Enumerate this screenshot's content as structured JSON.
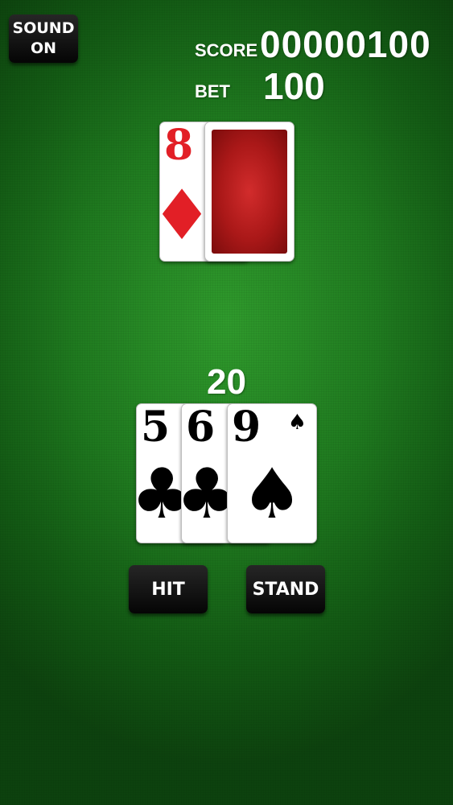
{
  "controls": {
    "sound_line1": "SOUND",
    "sound_line2": "ON",
    "hit_label": "HIT",
    "stand_label": "STAND"
  },
  "hud": {
    "score_label": "SCORE",
    "score_value": "00000100",
    "bet_label": "BET",
    "bet_value": "100"
  },
  "dealer": {
    "cards": [
      {
        "rank": "8",
        "suit": "diamonds",
        "suit_symbol": "♦",
        "color": "#e21f26",
        "face_up": true
      },
      {
        "face_up": false,
        "back_color": "#b81c1c"
      }
    ]
  },
  "player": {
    "total": "20",
    "cards": [
      {
        "rank": "5",
        "suit": "clubs",
        "suit_symbol": "♣",
        "color": "#000000"
      },
      {
        "rank": "6",
        "suit": "clubs",
        "suit_symbol": "♣",
        "color": "#000000"
      },
      {
        "rank": "9",
        "suit": "spades",
        "suit_symbol": "♠",
        "color": "#000000"
      }
    ]
  },
  "theme": {
    "table_felt": "#1f7a1f",
    "button_bg": "#111111",
    "text": "#ffffff"
  }
}
